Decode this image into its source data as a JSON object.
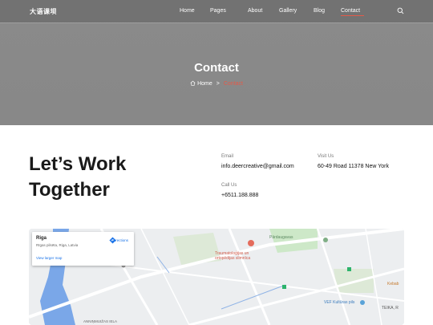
{
  "header": {
    "logo": "大语课坝",
    "nav": [
      {
        "label": "Home",
        "active": false
      },
      {
        "label": "Pages",
        "active": false
      },
      {
        "label": "About",
        "active": false
      },
      {
        "label": "Gallery",
        "active": false
      },
      {
        "label": "Blog",
        "active": false
      },
      {
        "label": "Contact",
        "active": true
      }
    ],
    "search_icon": "search-icon",
    "accent_color": "#e25b4a"
  },
  "hero": {
    "title": "Contact",
    "breadcrumb": {
      "home": "Home",
      "separator": ">",
      "current": "Contact"
    }
  },
  "contact": {
    "headline_line1": "Let’s Work",
    "headline_line2": "Together",
    "email_label": "Email",
    "email_value": "info.deercreative@gmail.com",
    "visit_label": "Visit Us",
    "visit_value": "60-49 Road 11378 New York",
    "call_label": "Call Us",
    "call_value": "+6511.188.888"
  },
  "map": {
    "place_title": "Riga",
    "place_address": "Rīgas pilsēta, Riga, Latvia",
    "directions_label": "Directions",
    "larger_map_link": "View larger map",
    "labels": {
      "hospital": "Traumatoloģijas un ortopēdijas slimnīca",
      "park": "Pārdaugavas",
      "vef": "VEF Kultūras pils",
      "kebab": "Kebab",
      "teika": "TEIKA, R",
      "street": "ANNIŅMUIŽAS IELA"
    },
    "colors": {
      "water": "#7aa7e8",
      "park": "#cde8c8",
      "road": "#ffffff",
      "land": "#eceef0"
    }
  }
}
